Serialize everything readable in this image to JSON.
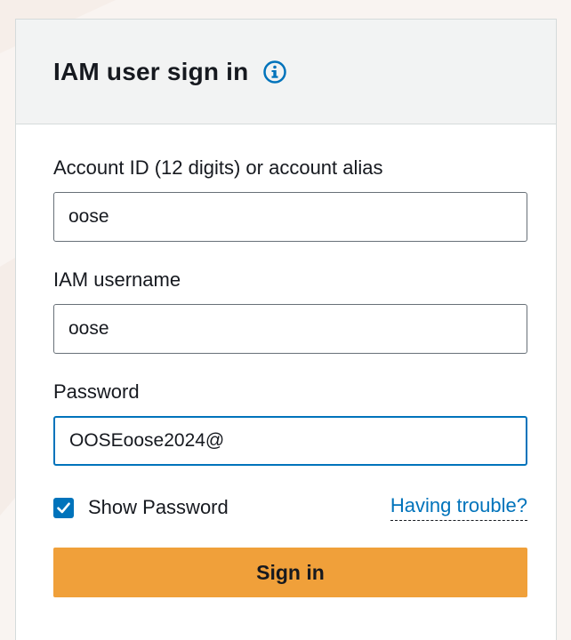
{
  "header": {
    "title": "IAM user sign in",
    "info_icon": "info-icon"
  },
  "form": {
    "account_label": "Account ID (12 digits) or account alias",
    "account_value": "oose",
    "username_label": "IAM username",
    "username_value": "oose",
    "password_label": "Password",
    "password_value": "OOSEoose2024@",
    "show_password_label": "Show Password",
    "show_password_checked": true,
    "trouble_link": "Having trouble?",
    "submit_label": "Sign in"
  },
  "colors": {
    "accent": "#0073bb",
    "button": "#f0a03a",
    "header_bg": "#f2f3f3"
  }
}
